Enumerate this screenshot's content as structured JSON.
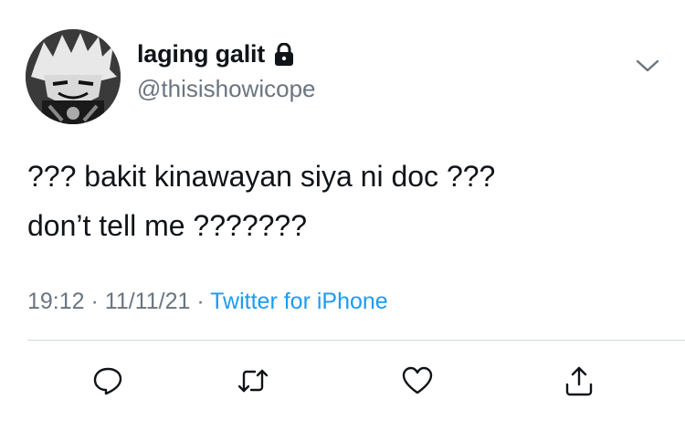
{
  "user": {
    "display_name": "laging galit",
    "handle": "@thisishowicope",
    "protected_icon": "lock-icon"
  },
  "tweet": {
    "lines": [
      "??? bakit kinawayan siya ni doc ???",
      "don’t tell me ???????"
    ]
  },
  "meta": {
    "time": "19:12",
    "separator_1": " · ",
    "date": "11/11/21",
    "separator_2": " · ",
    "source": "Twitter for iPhone"
  },
  "actions": [
    {
      "name": "reply",
      "icon": "reply-icon"
    },
    {
      "name": "retweet",
      "icon": "retweet-icon"
    },
    {
      "name": "like",
      "icon": "heart-icon"
    },
    {
      "name": "share",
      "icon": "share-icon"
    }
  ],
  "colors": {
    "text": "#0f1419",
    "secondary": "#6a7580",
    "link": "#1d9bf0",
    "divider": "#cfd9de"
  }
}
